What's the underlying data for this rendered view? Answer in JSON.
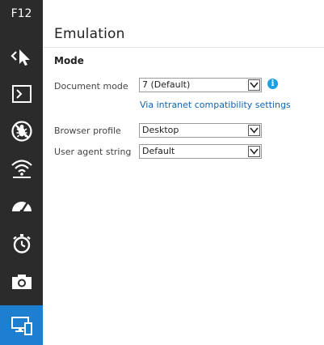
{
  "sidebar": {
    "header": "F12",
    "tools": [
      {
        "name": "dom-explorer",
        "icon": "select-element-icon"
      },
      {
        "name": "console",
        "icon": "console-icon"
      },
      {
        "name": "debugger",
        "icon": "debugger-bug-icon"
      },
      {
        "name": "network",
        "icon": "network-wifi-icon"
      },
      {
        "name": "ui-responsiveness",
        "icon": "speedometer-icon"
      },
      {
        "name": "profiler",
        "icon": "stopwatch-icon"
      },
      {
        "name": "memory",
        "icon": "camera-icon"
      },
      {
        "name": "emulation",
        "icon": "emulation-devices-icon",
        "active": true
      }
    ]
  },
  "panel": {
    "title": "Emulation",
    "section_mode": "Mode",
    "document_mode": {
      "label": "Document mode",
      "value": "7 (Default)",
      "info_icon": "info-icon",
      "link": "Via intranet compatibility settings"
    },
    "browser_profile": {
      "label": "Browser profile",
      "value": "Desktop"
    },
    "user_agent": {
      "label": "User agent string",
      "value": "Default"
    }
  },
  "colors": {
    "sidebar_bg": "#2b2b2b",
    "active_tool": "#1e7fd0",
    "link": "#0f64b4",
    "info": "#1ba1e2"
  }
}
